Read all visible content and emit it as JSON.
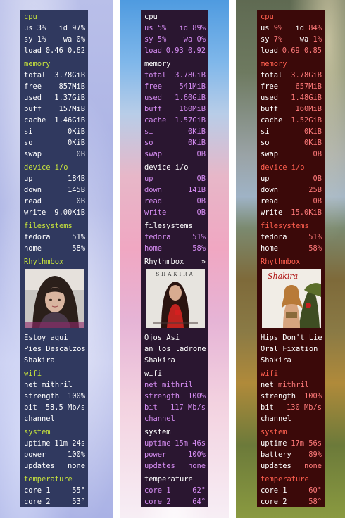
{
  "panels": [
    {
      "cpu": {
        "title": "cpu",
        "us_label": "us",
        "us": "3%",
        "id_label": "id",
        "id": "97%",
        "sy_label": "sy",
        "sy": "1%",
        "wa_label": "wa",
        "wa": "0%",
        "load_label": "load",
        "load": "0.46 0.62"
      },
      "memory": {
        "title": "memory",
        "total": "3.78GiB",
        "free": "857MiB",
        "used": "1.37GiB",
        "buff": "157MiB",
        "cache": "1.46GiB",
        "si": "0KiB",
        "so": "0KiB",
        "swap": "0B"
      },
      "io": {
        "title": "device i/o",
        "up": "184B",
        "down": "145B",
        "read": "0B",
        "write": "9.00KiB"
      },
      "fs": {
        "title": "filesystems",
        "fedora": "51%",
        "home": "58%"
      },
      "music": {
        "title": "Rhythmbox",
        "indicator": "",
        "song": [
          "Estoy aqui",
          "Pies Descalzos",
          "Shakira"
        ]
      },
      "wifi": {
        "title": "wifi",
        "net": "mithril",
        "strength": "100%",
        "bit": "58.5 Mb/s",
        "channel": ""
      },
      "system": {
        "title": "system",
        "uptime": "11m 24s",
        "power_label": "power",
        "power": "100%",
        "updates": "none"
      },
      "temp": {
        "title": "temperature",
        "core1": "55°",
        "core2": "53°"
      }
    },
    {
      "cpu": {
        "title": "cpu",
        "us_label": "us",
        "us": "5%",
        "id_label": "id",
        "id": "89%",
        "sy_label": "sy",
        "sy": "5%",
        "wa_label": "wa",
        "wa": "0%",
        "load_label": "load",
        "load": "0.93 0.92"
      },
      "memory": {
        "title": "memory",
        "total": "3.78GiB",
        "free": "541MiB",
        "used": "1.60GiB",
        "buff": "160MiB",
        "cache": "1.57GiB",
        "si": "0KiB",
        "so": "0KiB",
        "swap": "0B"
      },
      "io": {
        "title": "device i/o",
        "up": "0B",
        "down": "141B",
        "read": "0B",
        "write": "0B"
      },
      "fs": {
        "title": "filesystems",
        "fedora": "51%",
        "home": "58%"
      },
      "music": {
        "title": "Rhythmbox",
        "indicator": "»",
        "song": [
          "Ojos Así",
          "an los ladrone",
          "Shakira"
        ]
      },
      "wifi": {
        "title": "wifi",
        "net": "mithril",
        "strength": "100%",
        "bit": "117 Mb/s",
        "channel": ""
      },
      "system": {
        "title": "system",
        "uptime": "15m 46s",
        "power_label": "power",
        "power": "100%",
        "updates": "none"
      },
      "temp": {
        "title": "temperature",
        "core1": "62°",
        "core2": "64°"
      }
    },
    {
      "cpu": {
        "title": "cpu",
        "us_label": "us",
        "us": "9%",
        "id_label": "id",
        "id": "84%",
        "sy_label": "sy",
        "sy": "7%",
        "wa_label": "wa",
        "wa": "1%",
        "load_label": "load",
        "load": "0.69 0.85"
      },
      "memory": {
        "title": "memory",
        "total": "3.78GiB",
        "free": "657MiB",
        "used": "1.48GiB",
        "buff": "160MiB",
        "cache": "1.52GiB",
        "si": "0KiB",
        "so": "0KiB",
        "swap": "0B"
      },
      "io": {
        "title": "device i/o",
        "up": "0B",
        "down": "25B",
        "read": "0B",
        "write": "15.0KiB"
      },
      "fs": {
        "title": "filesystems",
        "fedora": "51%",
        "home": "58%"
      },
      "music": {
        "title": "Rhythmbox",
        "indicator": "",
        "song": [
          "Hips Don't Lie",
          "Oral Fixation",
          "Shakira"
        ]
      },
      "wifi": {
        "title": "wifi",
        "net": "mithril",
        "strength": "100%",
        "bit": "130 Mb/s",
        "channel": ""
      },
      "system": {
        "title": "system",
        "uptime": "17m 56s",
        "power_label": "battery",
        "power": "89%",
        "updates": "none"
      },
      "temp": {
        "title": "temperature",
        "core1": "60°",
        "core2": "58°"
      }
    }
  ],
  "labels": {
    "total": "total",
    "free": "free",
    "used": "used",
    "buff": "buff",
    "cache": "cache",
    "si": "si",
    "so": "so",
    "swap": "swap",
    "up": "up",
    "down": "down",
    "read": "read",
    "write": "write",
    "fedora": "fedora",
    "home": "home",
    "net": "net",
    "strength": "strength",
    "bit": "bit",
    "channel": "channel",
    "uptime": "uptime",
    "updates": "updates",
    "core1": "core 1",
    "core2": "core 2"
  },
  "album_art_texts": [
    "",
    "SHAKIRA",
    "Shakira"
  ],
  "colors": {
    "panel1_bg": "#30395f",
    "panel1_header": "#c7e33c",
    "panel2_bg": "#2a1630",
    "panel2_accent": "#d58cf2",
    "panel3_bg": "#3b0909",
    "panel3_header": "#ff5f4f"
  }
}
